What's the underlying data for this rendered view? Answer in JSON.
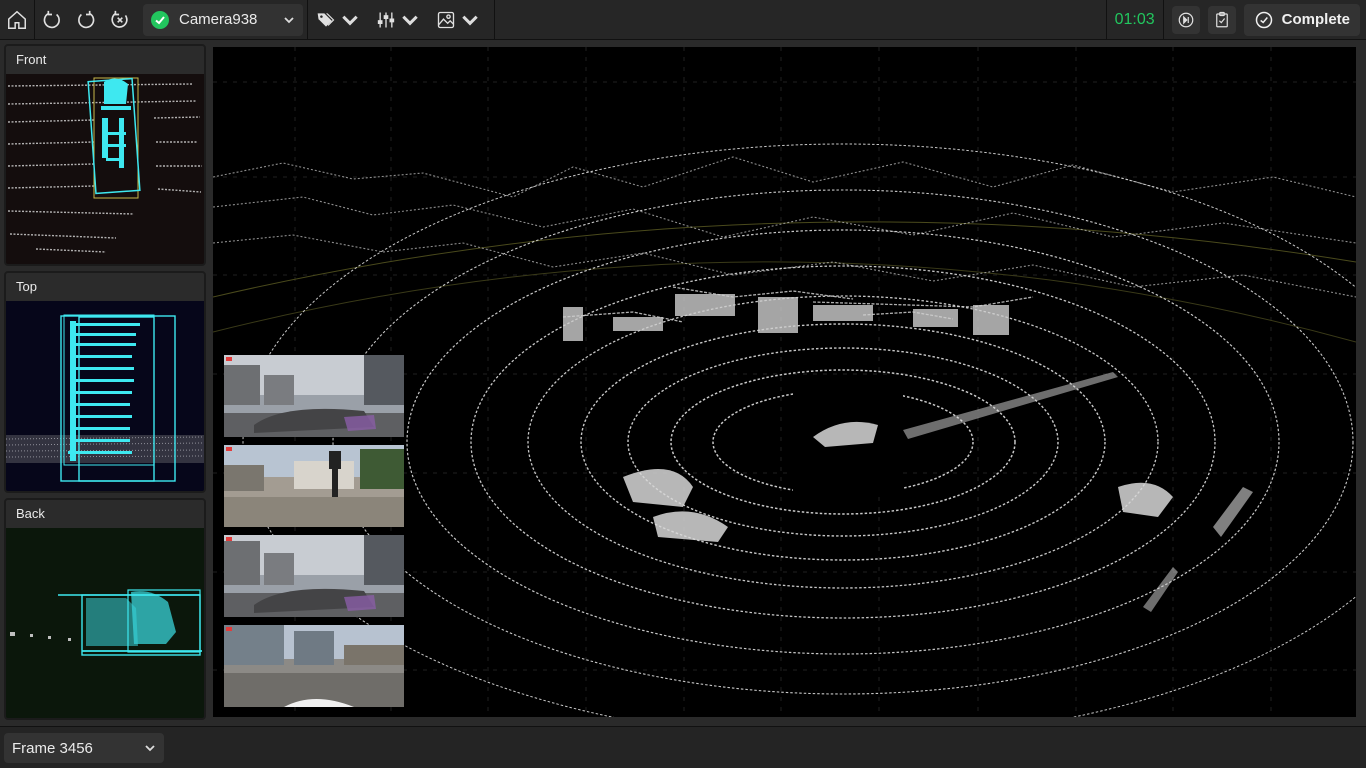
{
  "toolbar": {
    "camera": "Camera938",
    "timer": "01:03",
    "complete_label": "Complete"
  },
  "views": {
    "front": "Front",
    "top": "Top",
    "back": "Back"
  },
  "footer": {
    "frame": "Frame 3456"
  },
  "colors": {
    "accent_green": "#22c55e",
    "box_cyan": "#3ee8f0",
    "box_yellow": "#c7b94a"
  }
}
